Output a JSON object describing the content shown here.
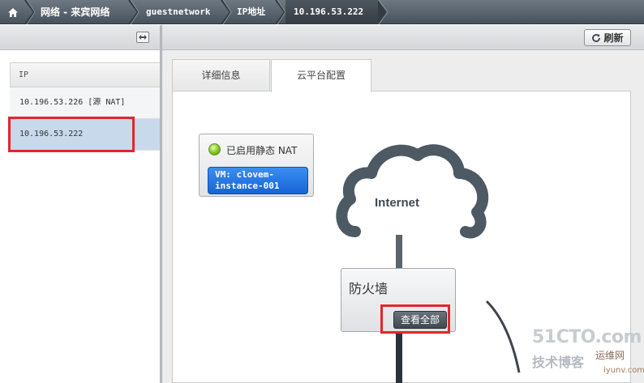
{
  "breadcrumb": {
    "home_icon": "home-icon",
    "items": [
      {
        "label": "网络 - 来宾网络"
      },
      {
        "label": "guestnetwork"
      },
      {
        "label": "IP地址"
      },
      {
        "label": "10.196.53.222"
      }
    ]
  },
  "left_panel": {
    "collapse_icon": "collapse-arrows-icon",
    "list_header": "IP",
    "items": [
      {
        "label": "10.196.53.226 [源 NAT]"
      },
      {
        "label": "10.196.53.222",
        "selected": true
      }
    ]
  },
  "toolbar": {
    "refresh_label": "刷新",
    "refresh_icon": "refresh-icon"
  },
  "tabs": [
    {
      "label": "详细信息",
      "active": false
    },
    {
      "label": "云平台配置",
      "active": true
    }
  ],
  "nat_box": {
    "status_icon": "green-led-icon",
    "status_label": "已启用静态 NAT",
    "vm_line1": "VM: clovem-",
    "vm_line2": "instance-001"
  },
  "diagram": {
    "cloud_label": "Internet",
    "firewall_title": "防火墙",
    "firewall_button": "查看全部"
  },
  "watermark": {
    "brand": "51CTO.com",
    "subtitle": "技术博客",
    "tag": "运维网",
    "url": "iyunv.com"
  },
  "colors": {
    "highlight_red": "#e3262b",
    "selected_row": "#c8d9ec",
    "vm_pill_blue": "#1764d6",
    "breadcrumb_dark": "#48525c"
  }
}
